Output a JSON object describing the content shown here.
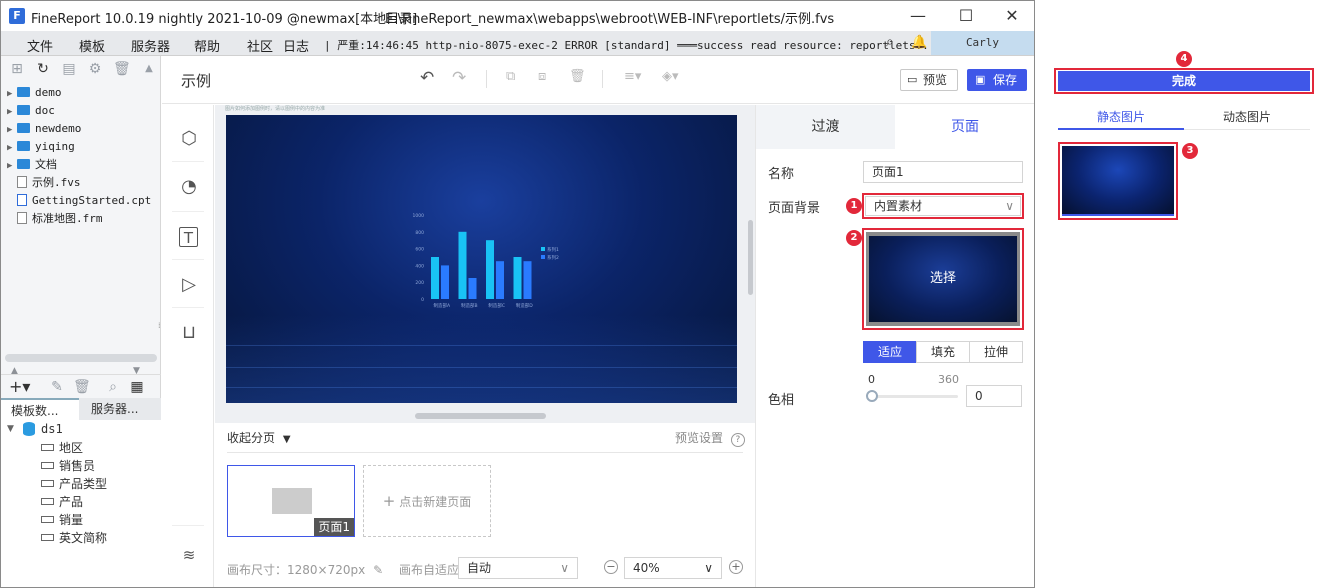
{
  "window": {
    "title": "FineReport 10.0.19 nightly 2021-10-09 @newmax[本地目录]",
    "path": "E:\\FineReport_newmax\\webapps\\webroot\\WEB-INF\\reportlets/示例.fvs",
    "logo_text": "F",
    "minimize": "—",
    "maximize": "☐",
    "close": "✕"
  },
  "menubar": {
    "items": [
      "文件",
      "模板",
      "服务器",
      "帮助",
      "社区",
      "日志"
    ],
    "log": "| 严重:14:46:45 http-nio-8075-exec-2 ERROR [standard] ═══success read resource: reportlets...",
    "user": "Carly"
  },
  "filetree": [
    {
      "label": "demo",
      "type": "folder"
    },
    {
      "label": "doc",
      "type": "folder"
    },
    {
      "label": "newdemo",
      "type": "folder"
    },
    {
      "label": "yiqing",
      "type": "folder"
    },
    {
      "label": "文档",
      "type": "folder"
    },
    {
      "label": "示例.fvs",
      "type": "file"
    },
    {
      "label": "GettingStarted.cpt",
      "type": "file"
    },
    {
      "label": "标准地图.frm",
      "type": "file"
    }
  ],
  "bottom_tabs": [
    "模板数...",
    "服务器..."
  ],
  "datasets": {
    "name": "ds1",
    "fields": [
      "地区",
      "销售员",
      "产品类型",
      "产品",
      "销量",
      "英文简称"
    ]
  },
  "editor": {
    "title": "示例",
    "preview_label": "预览",
    "save_label": "保存",
    "canvas_hint": "图片如何添加图例时，请以图例中的内容为准"
  },
  "chart_data": {
    "type": "bar",
    "categories": [
      "制造部A",
      "制造部B",
      "制造部C",
      "制造部D"
    ],
    "series": [
      {
        "name": "系列1",
        "values": [
          500,
          800,
          700,
          500
        ]
      },
      {
        "name": "系列2",
        "values": [
          400,
          250,
          450,
          450
        ]
      }
    ],
    "ylim": [
      0,
      1000
    ],
    "yticks": [
      "1000",
      "800",
      "600",
      "400",
      "200",
      "0"
    ],
    "colors": [
      "#19c3f5",
      "#2a7bff"
    ]
  },
  "pages_panel": {
    "collapse_label": "收起分页",
    "preview_settings": "预览设置",
    "page_name": "页面1",
    "new_page": "点击新建页面",
    "canvas_size_label": "画布尺寸：",
    "canvas_size": "1280×720px",
    "adapt_label": "画布自适应:",
    "adapt_value": "自动",
    "zoom": "40%"
  },
  "properties": {
    "tab_transition": "过渡",
    "tab_page": "页面",
    "name_label": "名称",
    "name_value": "页面1",
    "bg_label": "页面背景",
    "bg_value": "内置素材",
    "choose_label": "选择",
    "fit_options": [
      "适应",
      "填充",
      "拉伸"
    ],
    "hue_label": "色相",
    "hue_min": "0",
    "hue_max": "360",
    "hue_value": "0"
  },
  "popup": {
    "done_label": "完成",
    "tabs": [
      "静态图片",
      "动态图片"
    ]
  },
  "badges": [
    "1",
    "2",
    "3",
    "4"
  ],
  "colors": {
    "accent": "#3f57e8",
    "badge": "#e2283a",
    "menubar": "#e7e9ec"
  }
}
